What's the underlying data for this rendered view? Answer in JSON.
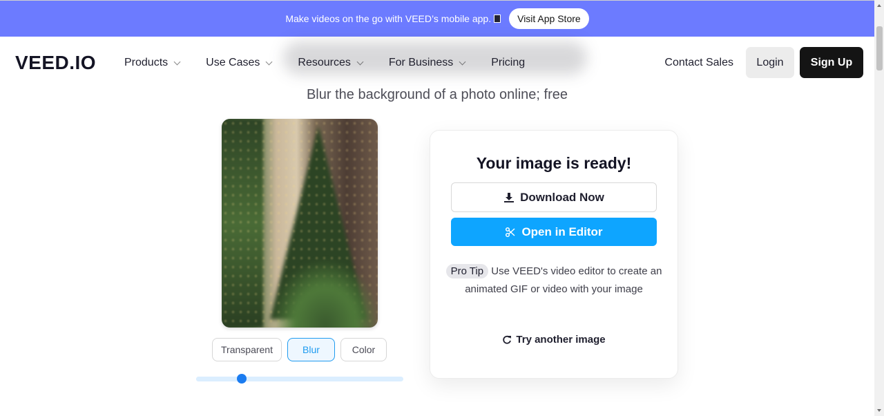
{
  "banner": {
    "message": "Make videos on the go with VEED’s mobile app.",
    "button": "Visit App Store"
  },
  "nav": {
    "logo": "VEED.IO",
    "menu": [
      "Products",
      "Use Cases",
      "Resources",
      "For Business",
      "Pricing"
    ],
    "contact": "Contact Sales",
    "login": "Login",
    "signup": "Sign Up"
  },
  "page": {
    "subtitle": "Blur the background of a photo online; free"
  },
  "editor": {
    "modes": [
      "Transparent",
      "Blur",
      "Color"
    ],
    "selected_mode": "Blur",
    "blur_level": 0.22
  },
  "result": {
    "heading": "Your image is ready!",
    "download": "Download Now",
    "open_editor": "Open in Editor",
    "tip_badge": "Pro Tip",
    "tip_text": "Use VEED's video editor to create an animated GIF or video with your image",
    "try_again": "Try another image"
  },
  "colors": {
    "banner": "#6c7bff",
    "primary": "#0ea5ff",
    "dark": "#141414"
  }
}
